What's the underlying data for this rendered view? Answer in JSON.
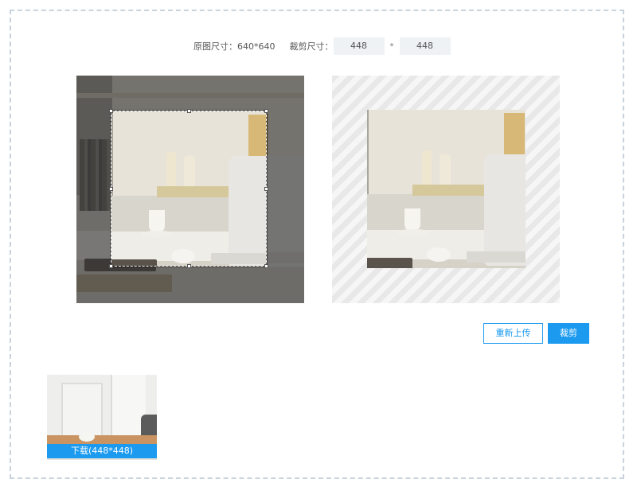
{
  "info": {
    "original_size_label": "原图尺寸：640*640",
    "crop_size_label": "裁剪尺寸：",
    "crop_width": "448",
    "times_sign": "*",
    "crop_height": "448"
  },
  "buttons": {
    "reupload_label": "重新上传",
    "crop_label": "裁剪"
  },
  "result": {
    "download_label": "下载(448*448)"
  },
  "colors": {
    "accent": "#1b9aef",
    "frame_border": "#c9d3de",
    "input_bg": "#eff2f5"
  }
}
